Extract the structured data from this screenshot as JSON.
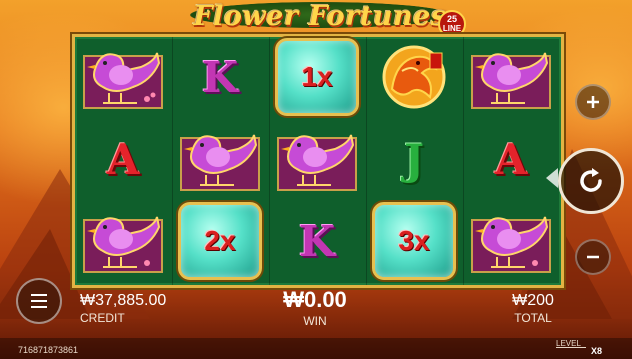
{
  "game": {
    "title": "Flower Fortunes",
    "badge_number": "25",
    "badge_text": "LINE"
  },
  "reels": [
    [
      "bird",
      "bird",
      "bird"
    ],
    [
      "K",
      "bird",
      "2x"
    ],
    [
      "1x",
      "bird",
      "K"
    ],
    [
      "phoenix",
      "J",
      "3x"
    ],
    [
      "bird",
      "A",
      "bird"
    ]
  ],
  "symbols": {
    "r0c1": "A",
    "r1c0": "K",
    "r1c2": "2x",
    "r2c0": "1x",
    "r2c2": "K",
    "r3c1": "J",
    "r3c2": "3x",
    "r4c1": "A"
  },
  "colors": {
    "reel_bg": "#0f5f2c",
    "gold": "#e2b443",
    "multiplier_text": "#d92020",
    "letter_k": "#c236b3",
    "letter_a": "#e4232b",
    "letter_j": "#28b03e"
  },
  "controls": {
    "plus_icon": "plus-icon",
    "spin_icon": "refresh-icon",
    "minus_icon": "minus-icon",
    "menu_icon": "hamburger-icon"
  },
  "stats": {
    "credit_value": "₩37,885.00",
    "credit_label": "CREDIT",
    "win_value": "₩0.00",
    "win_label": "WIN",
    "total_value": "₩200",
    "total_label": "TOTAL"
  },
  "footer": {
    "round_id": "716871873861",
    "level_label": "LEVEL",
    "level_value": "X8"
  }
}
